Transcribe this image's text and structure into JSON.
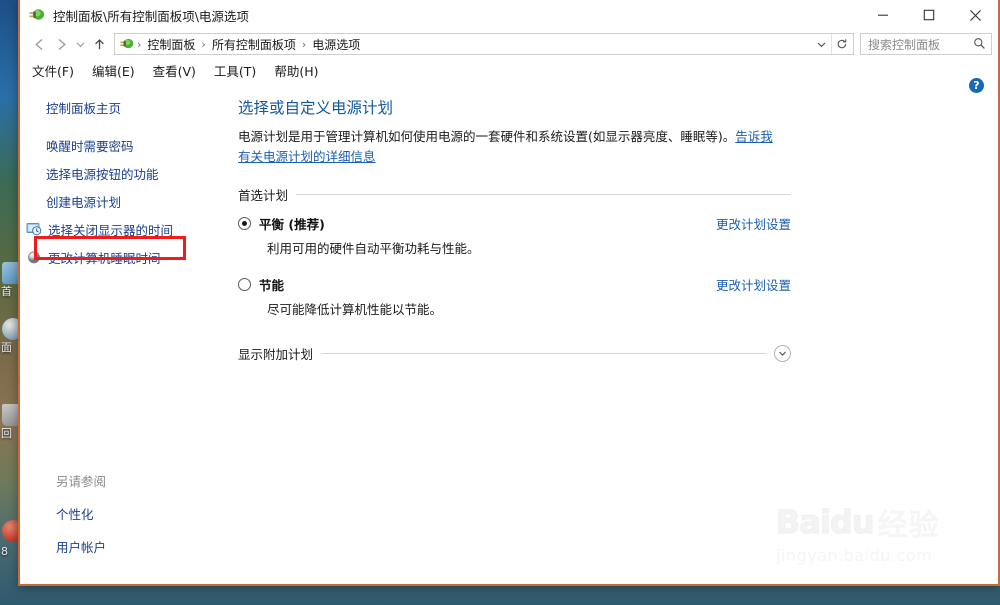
{
  "desktop": {
    "icons": [
      {
        "name": "desktop-icon-1",
        "label": "首"
      },
      {
        "name": "desktop-icon-2",
        "label": "面"
      },
      {
        "name": "desktop-icon-3",
        "label": "回"
      },
      {
        "name": "desktop-icon-4",
        "label": "8"
      }
    ]
  },
  "window": {
    "title": "控制面板\\所有控制面板项\\电源选项",
    "title_icon": "power-plug-icon",
    "caption": {
      "minimize": "minimize-icon",
      "maximize": "maximize-icon",
      "close": "close-icon"
    }
  },
  "addressbar": {
    "back": "back-arrow-icon",
    "forward": "forward-arrow-icon",
    "recent": "chevron-down-icon",
    "up": "up-arrow-icon",
    "path_icon": "power-plug-icon",
    "crumbs": [
      "控制面板",
      "所有控制面板项",
      "电源选项"
    ],
    "separator": "›",
    "dropdown": "chevron-down-icon",
    "refresh": "refresh-icon"
  },
  "search": {
    "placeholder": "搜索控制面板",
    "icon": "search-icon"
  },
  "menubar": {
    "items": [
      {
        "label": "文件(F)",
        "name": "menu-file"
      },
      {
        "label": "编辑(E)",
        "name": "menu-edit"
      },
      {
        "label": "查看(V)",
        "name": "menu-view"
      },
      {
        "label": "工具(T)",
        "name": "menu-tools"
      },
      {
        "label": "帮助(H)",
        "name": "menu-help"
      }
    ]
  },
  "sidebar": {
    "items": [
      {
        "label": "控制面板主页",
        "icon": null
      },
      {
        "label": "唤醒时需要密码",
        "icon": null
      },
      {
        "label": "选择电源按钮的功能",
        "icon": null,
        "highlighted": true
      },
      {
        "label": "创建电源计划",
        "icon": null
      },
      {
        "label": "选择关闭显示器的时间",
        "icon": "monitor-clock-icon"
      },
      {
        "label": "更改计算机睡眠时间",
        "icon": "sleep-moon-icon"
      }
    ],
    "see_also": {
      "title": "另请参阅",
      "items": [
        {
          "label": "个性化"
        },
        {
          "label": "用户帐户"
        }
      ]
    }
  },
  "main": {
    "heading": "选择或自定义电源计划",
    "description_text": "电源计划是用于管理计算机如何使用电源的一套硬件和系统设置(如显示器亮度、睡眠等)。",
    "description_link": "告诉我有关电源计划的详细信息",
    "preferred_section_label": "首选计划",
    "plans": [
      {
        "name": "平衡 (推荐)",
        "description": "利用可用的硬件自动平衡功耗与性能。",
        "selected": true,
        "link": "更改计划设置"
      },
      {
        "name": "节能",
        "description": "尽可能降低计算机性能以节能。",
        "selected": false,
        "link": "更改计划设置"
      }
    ],
    "additional_label": "显示附加计划",
    "additional_toggle_icon": "chevron-down-icon",
    "help_icon_label": "?"
  },
  "watermark": {
    "brand_latin": "Baidu",
    "brand_cn": "经验",
    "url": "jingyan.baidu.com"
  },
  "colors": {
    "window_border": "#c86a3c",
    "link": "#1b3f8f",
    "heading": "#13599e",
    "highlight": "#f01c1c",
    "help_badge": "#1569b8"
  }
}
